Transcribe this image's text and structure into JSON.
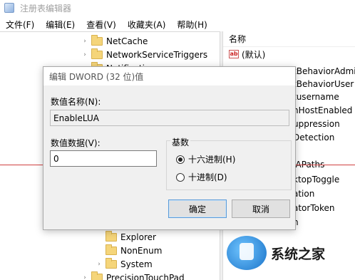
{
  "app": {
    "title": "注册表编辑器"
  },
  "menu": [
    "文件(F)",
    "编辑(E)",
    "查看(V)",
    "收藏夹(A)",
    "帮助(H)"
  ],
  "tree": {
    "items": [
      {
        "label": "NetCache",
        "expander": "›"
      },
      {
        "label": "NetworkServiceTriggers",
        "expander": "›"
      },
      {
        "label": "Notifications",
        "expander": "›"
      },
      {
        "label": "Explorer",
        "expander": ""
      },
      {
        "label": "NonEnum",
        "expander": ""
      },
      {
        "label": "System",
        "expander": "›"
      },
      {
        "label": "PrecisionTouchPad",
        "expander": "›"
      }
    ]
  },
  "list": {
    "header": "名称",
    "rows": [
      "(默认)",
      "tBehaviorAdmin",
      "tBehaviorUser",
      "tusername",
      "nHostEnabled",
      "uppression",
      "Detection",
      "IAPaths",
      "ktopToggle",
      "ation",
      "atorToken",
      "n"
    ]
  },
  "dialog": {
    "title": "编辑 DWORD (32 位)值",
    "name_label": "数值名称(N):",
    "name_value": "EnableLUA",
    "data_label": "数值数据(V):",
    "data_value": "0",
    "base_label": "基数",
    "radio_hex": "十六进制(H)",
    "radio_dec": "十进制(D)",
    "ok": "确定",
    "cancel": "取消"
  },
  "watermark": {
    "text": "系统之家"
  }
}
